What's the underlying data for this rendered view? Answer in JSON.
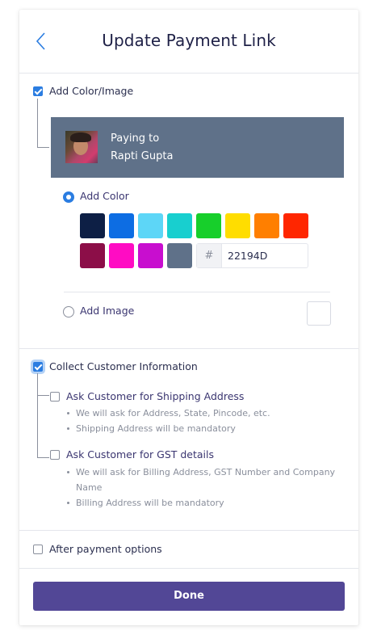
{
  "header": {
    "title": "Update Payment Link"
  },
  "color_image": {
    "label": "Add Color/Image",
    "checked": true,
    "preview": {
      "paying_to": "Paying to",
      "payer_name": "Rapti Gupta",
      "background": "#5f7189"
    },
    "add_color": {
      "label": "Add Color",
      "selected": true
    },
    "swatches": [
      "#0d1f45",
      "#0d6de3",
      "#5dd6f7",
      "#18cfcf",
      "#17cf2b",
      "#ffdd00",
      "#ff7f00",
      "#ff2600",
      "#8c0e48",
      "#ff0cc3",
      "#c80ecf",
      "#5f7189"
    ],
    "hex": {
      "prefix": "#",
      "value": "22194D"
    },
    "add_image": {
      "label": "Add Image",
      "selected": false
    }
  },
  "customer_info": {
    "label": "Collect Customer Information",
    "checked": true,
    "options": [
      {
        "label": "Ask Customer for Shipping Address",
        "checked": false,
        "notes": [
          "We will ask for Address, State, Pincode, etc.",
          "Shipping Address will be mandatory"
        ]
      },
      {
        "label": "Ask Customer for GST details",
        "checked": false,
        "notes": [
          "We will ask for Billing Address, GST Number and Company",
          "Name",
          "Billing Address will be mandatory"
        ]
      }
    ]
  },
  "after_payment": {
    "label": "After payment options",
    "checked": false
  },
  "footer": {
    "done_label": "Done"
  },
  "colors": {
    "accent": "#2b7de1",
    "primary_button": "#524796",
    "text": "#2b2f4f",
    "muted": "#8a8f9c"
  }
}
